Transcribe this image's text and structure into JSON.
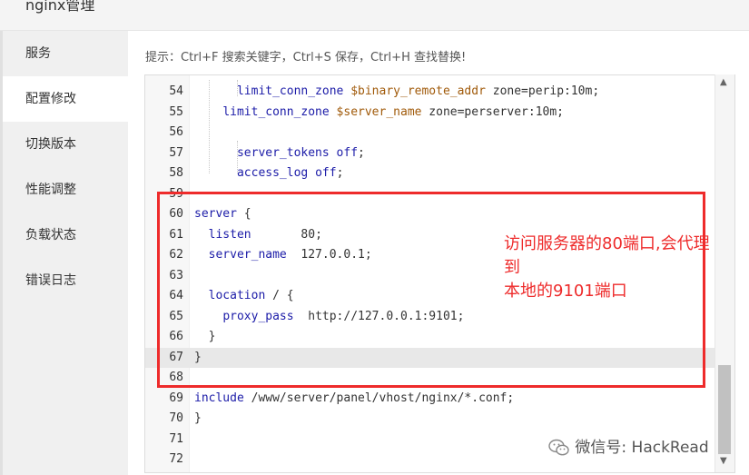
{
  "window": {
    "title": "nginx管理"
  },
  "sidebar": {
    "items": [
      {
        "label": "服务"
      },
      {
        "label": "配置修改",
        "active": true
      },
      {
        "label": "切换版本"
      },
      {
        "label": "性能调整"
      },
      {
        "label": "负载状态"
      },
      {
        "label": "错误日志"
      }
    ]
  },
  "hint": "提示：Ctrl+F 搜索关键字，Ctrl+S 保存，Ctrl+H 查找替换!",
  "editor": {
    "lines": [
      {
        "num": "54",
        "text": "      limit_conn_zone $binary_remote_addr zone=perip:10m;"
      },
      {
        "num": "55",
        "text": "    limit_conn_zone $server_name zone=perserver:10m;"
      },
      {
        "num": "56",
        "text": ""
      },
      {
        "num": "57",
        "text": "      server_tokens off;"
      },
      {
        "num": "58",
        "text": "      access_log off;"
      },
      {
        "num": "59",
        "text": ""
      },
      {
        "num": "60",
        "text": "server {"
      },
      {
        "num": "61",
        "text": "  listen       80;"
      },
      {
        "num": "62",
        "text": "  server_name  127.0.0.1;"
      },
      {
        "num": "63",
        "text": ""
      },
      {
        "num": "64",
        "text": "  location / {"
      },
      {
        "num": "65",
        "text": "    proxy_pass  http://127.0.0.1:9101;"
      },
      {
        "num": "66",
        "text": "  }"
      },
      {
        "num": "67",
        "text": "}"
      },
      {
        "num": "68",
        "text": ""
      },
      {
        "num": "69",
        "text": "include /www/server/panel/vhost/nginx/*.conf;"
      },
      {
        "num": "70",
        "text": "}"
      },
      {
        "num": "71",
        "text": ""
      },
      {
        "num": "72",
        "text": ""
      }
    ]
  },
  "annotation": {
    "line1": "访问服务器的80端口,会代理",
    "line2": "到",
    "line3": "本地的9101端口"
  },
  "watermark": {
    "text": "微信号: HackRead"
  },
  "colors": {
    "annotation": "#ee2b2b",
    "active_line": "#e8e8e8"
  }
}
